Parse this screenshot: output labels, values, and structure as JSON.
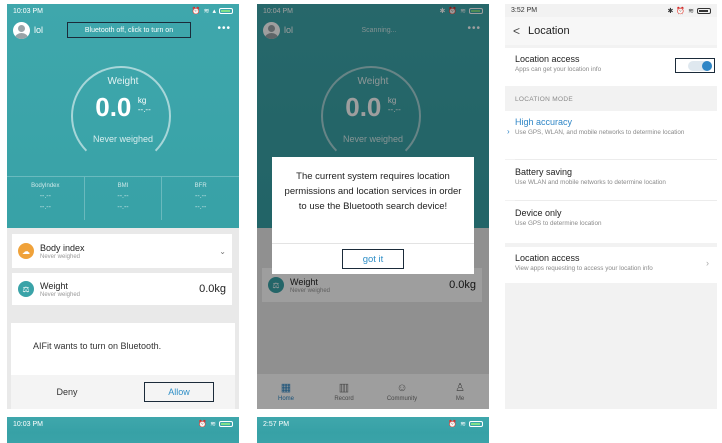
{
  "panel1": {
    "status_time": "10:03 PM",
    "username": "lol",
    "bluetooth_notice": "Bluetooth off, click to turn on",
    "more_glyph": "•••",
    "gauge_title": "Weight",
    "gauge_value": "0.0",
    "gauge_unit": "kg",
    "gauge_unit_sub": "--.--",
    "gauge_sub": "Never weighed",
    "metrics": [
      {
        "label": "BodyIndex",
        "value": "--.--",
        "value2": "--.--"
      },
      {
        "label": "BMI",
        "value": "--.--",
        "value2": "--.--"
      },
      {
        "label": "BFR",
        "value": "--.--",
        "value2": "--.--"
      }
    ],
    "card_body": {
      "title": "Body index",
      "sub": "Never weighed"
    },
    "card_weight": {
      "title": "Weight",
      "sub": "Never weighed",
      "value": "0.0kg"
    },
    "dialog": {
      "message": "AIFit wants to turn on Bluetooth.",
      "deny": "Deny",
      "allow": "Allow"
    }
  },
  "panel2": {
    "status_time": "10:04 PM",
    "username": "lol",
    "scanning": "Scanning...",
    "more_glyph": "•••",
    "gauge_title": "Weight",
    "gauge_value": "0.0",
    "gauge_unit": "kg",
    "gauge_unit_sub": "--.--",
    "gauge_sub": "Never weighed",
    "card_weight": {
      "title": "Weight",
      "sub": "Never weighed",
      "value": "0.0kg"
    },
    "permission_message": "The current system requires location permissions and location services in order to use the Bluetooth search device!",
    "got_it": "got it",
    "tabs": [
      {
        "label": "Home",
        "icon": "▦"
      },
      {
        "label": "Record",
        "icon": "▥"
      },
      {
        "label": "Community",
        "icon": "☺"
      },
      {
        "label": "Me",
        "icon": "♙"
      }
    ]
  },
  "panel3": {
    "status_time": "3:52 PM",
    "back_glyph": "<",
    "title": "Location",
    "location_access": {
      "title": "Location access",
      "sub": "Apps can get your location info",
      "enabled": true
    },
    "section_mode": "LOCATION MODE",
    "modes": [
      {
        "title": "High accuracy",
        "sub": "Use GPS, WLAN, and mobile networks to determine location",
        "selected": true
      },
      {
        "title": "Battery saving",
        "sub": "Use WLAN and mobile networks to determine location",
        "selected": false
      },
      {
        "title": "Device only",
        "sub": "Use GPS to determine location",
        "selected": false
      }
    ],
    "apps_access": {
      "title": "Location access",
      "sub": "View apps requesting to access your location info"
    }
  },
  "panel4": {
    "status_time": "10:03 PM"
  },
  "panel5": {
    "status_time": "2:57 PM"
  },
  "colors": {
    "teal": "#3aa3a8",
    "accent_blue": "#2f86c6",
    "body_index_icon": "#f0a23a",
    "weight_icon": "#3aa3a8"
  }
}
